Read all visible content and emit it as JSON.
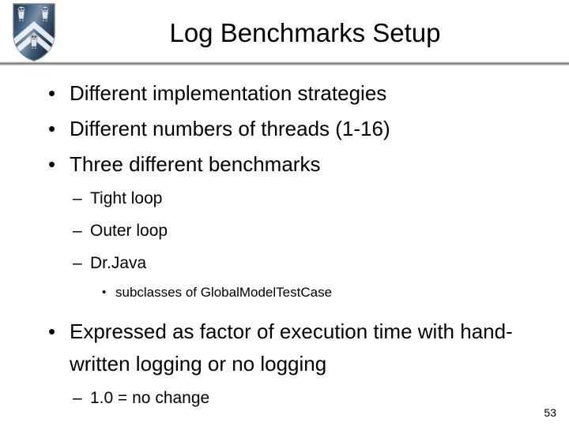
{
  "slide": {
    "title": "Log Benchmarks Setup",
    "page_number": "53",
    "logo": {
      "name": "rice-university-shield",
      "shield_dark": "#2b4663",
      "shield_mid": "#3f5f80",
      "shield_light": "#8fa8bd",
      "chevron": "#e8eef3",
      "owl": "#d9dde1"
    },
    "divider_color": "#6e7478"
  },
  "content": {
    "bullets": [
      {
        "level": 1,
        "marker": "•",
        "text": "Different implementation strategies"
      },
      {
        "level": 1,
        "marker": "•",
        "text": "Different numbers of threads (1-16)"
      },
      {
        "level": 1,
        "marker": "•",
        "text": "Three different benchmarks"
      },
      {
        "level": 2,
        "marker": "–",
        "text": "Tight loop"
      },
      {
        "level": 2,
        "marker": "–",
        "text": "Outer loop"
      },
      {
        "level": 2,
        "marker": "–",
        "text": "Dr.Java"
      },
      {
        "level": 3,
        "marker": "•",
        "text": "subclasses of GlobalModelTestCase"
      },
      {
        "level": 1,
        "marker": "•",
        "text": "Expressed as factor of execution time with hand-written logging or no logging"
      },
      {
        "level": 2,
        "marker": "–",
        "text": "1.0 = no change"
      }
    ]
  }
}
